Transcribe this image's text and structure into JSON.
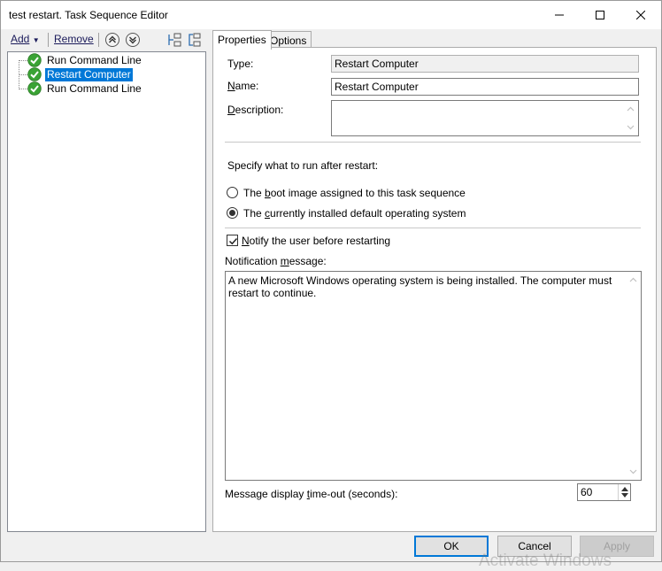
{
  "window": {
    "title": "test restart. Task Sequence Editor",
    "controls": {
      "minimize_icon": "minimize-icon",
      "maximize_icon": "maximize-icon",
      "close_icon": "close-icon"
    }
  },
  "toolbar": {
    "add_label": "Add",
    "remove_label": "Remove",
    "move_up_icon": "move-up-icon",
    "move_down_icon": "move-down-icon",
    "expand_icon": "expand-icon",
    "collapse_icon": "collapse-icon"
  },
  "tree": {
    "items": [
      {
        "label": "Run Command Line",
        "selected": false,
        "icon": "check-icon"
      },
      {
        "label": "Restart Computer",
        "selected": true,
        "icon": "check-icon"
      },
      {
        "label": "Run Command Line",
        "selected": false,
        "icon": "check-icon"
      }
    ]
  },
  "tabs": [
    {
      "label": "Properties",
      "active": true
    },
    {
      "label": "Options",
      "active": false
    }
  ],
  "properties": {
    "type_label": "Type:",
    "type_value": "Restart Computer",
    "name_label": "Name:",
    "name_value": "Restart Computer",
    "description_label": "Description:",
    "description_value": "",
    "specify_label": "Specify what to run after restart:",
    "radio_boot": "The boot image assigned to this task sequence",
    "radio_os": "The currently installed default operating system",
    "radio_selected": "os",
    "notify_label": "Notify the user before restarting",
    "notify_checked": true,
    "notification_label": "Notification message:",
    "notification_value": "A new Microsoft Windows operating system is being installed. The computer must restart to continue.",
    "timeout_label": "Message display time-out (seconds):",
    "timeout_value": "60"
  },
  "buttons": {
    "ok": "OK",
    "cancel": "Cancel",
    "apply": "Apply"
  },
  "watermark": "Activate Windows",
  "colors": {
    "selection": "#0078d7",
    "check_green": "#3aa335"
  }
}
